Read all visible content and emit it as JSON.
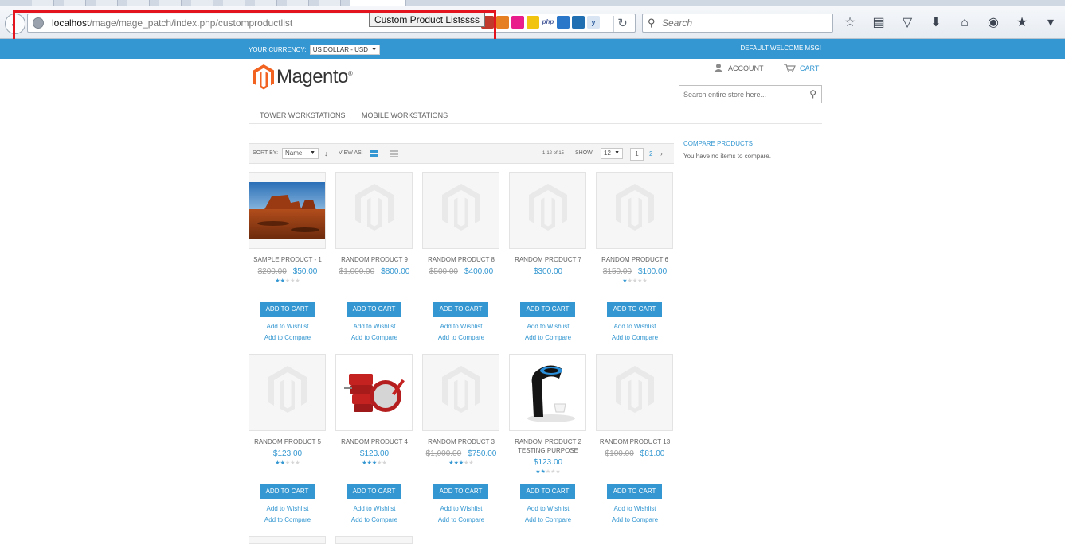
{
  "browser": {
    "url_host": "localhost",
    "url_path": "/mage/mage_patch/index.php/customproductlist",
    "tab_tooltip": "Custom Product Listssss",
    "search_placeholder": "Search"
  },
  "header": {
    "currency_label": "YOUR CURRENCY:",
    "currency_value": "US DOLLAR - USD",
    "welcome": "DEFAULT WELCOME MSG!",
    "logo_text": "Magento",
    "account": "ACCOUNT",
    "cart": "CART",
    "store_search_placeholder": "Search entire store here..."
  },
  "nav": [
    "TOWER WORKSTATIONS",
    "MOBILE WORKSTATIONS"
  ],
  "toolbar": {
    "sort_label": "SORT BY:",
    "sort_value": "Name",
    "view_label": "VIEW AS:",
    "count": "1-12 of 15",
    "show_label": "SHOW:",
    "show_value": "12",
    "page_current": "1",
    "page_next": "2"
  },
  "sidebar": {
    "compare_title": "COMPARE PRODUCTS",
    "compare_text": "You have no items to compare."
  },
  "product_actions": {
    "add_to_cart": "ADD TO CART",
    "wishlist": "Add to Wishlist",
    "compare": "Add to Compare"
  },
  "products": [
    {
      "name": "SAMPLE PRODUCT - 1",
      "old_price": "$200.00",
      "price": "$50.00",
      "rating": 2,
      "image": "desert-photo"
    },
    {
      "name": "RANDOM PRODUCT 9",
      "old_price": "$1,000.00",
      "price": "$800.00",
      "rating": 0,
      "image": "placeholder"
    },
    {
      "name": "RANDOM PRODUCT 8",
      "old_price": "$500.00",
      "price": "$400.00",
      "rating": 0,
      "image": "placeholder"
    },
    {
      "name": "RANDOM PRODUCT 7",
      "old_price": "",
      "price": "$300.00",
      "rating": 0,
      "image": "placeholder"
    },
    {
      "name": "RANDOM PRODUCT 6",
      "old_price": "$150.00",
      "price": "$100.00",
      "rating": 1,
      "image": "placeholder"
    },
    {
      "name": "RANDOM PRODUCT 5",
      "old_price": "",
      "price": "$123.00",
      "rating": 2,
      "image": "placeholder"
    },
    {
      "name": "RANDOM PRODUCT 4",
      "old_price": "",
      "price": "$123.00",
      "rating": 3,
      "image": "cookware-photo"
    },
    {
      "name": "RANDOM PRODUCT 3",
      "old_price": "$1,000.00",
      "price": "$750.00",
      "rating": 3,
      "image": "placeholder"
    },
    {
      "name": "RANDOM PRODUCT 2 TESTING PURPOSE",
      "old_price": "",
      "price": "$123.00",
      "rating": 2,
      "image": "coffee-machine-photo"
    },
    {
      "name": "RANDOM PRODUCT 13",
      "old_price": "$100.00",
      "price": "$81.00",
      "rating": 0,
      "image": "placeholder"
    }
  ],
  "colors": {
    "accent": "#3497d1",
    "highlight": "#e3141e",
    "text": "#636363"
  }
}
